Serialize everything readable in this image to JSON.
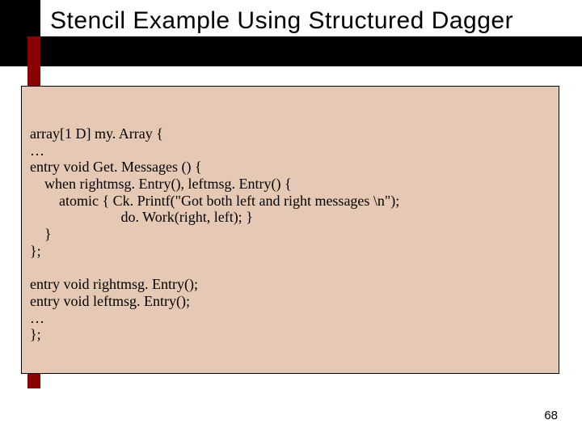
{
  "title": "Stencil Example Using Structured Dagger",
  "code": {
    "lines": [
      "array[1 D] my. Array {",
      "…",
      "entry void Get. Messages () {",
      "    when rightmsg. Entry(), leftmsg. Entry() {",
      "        atomic { Ck. Printf(\"Got both left and right messages \\n\");",
      "                         do. Work(right, left); }",
      "    }",
      "};",
      "",
      "entry void rightmsg. Entry();",
      "entry void leftmsg. Entry();",
      "…",
      "};"
    ]
  },
  "page_number": "68"
}
